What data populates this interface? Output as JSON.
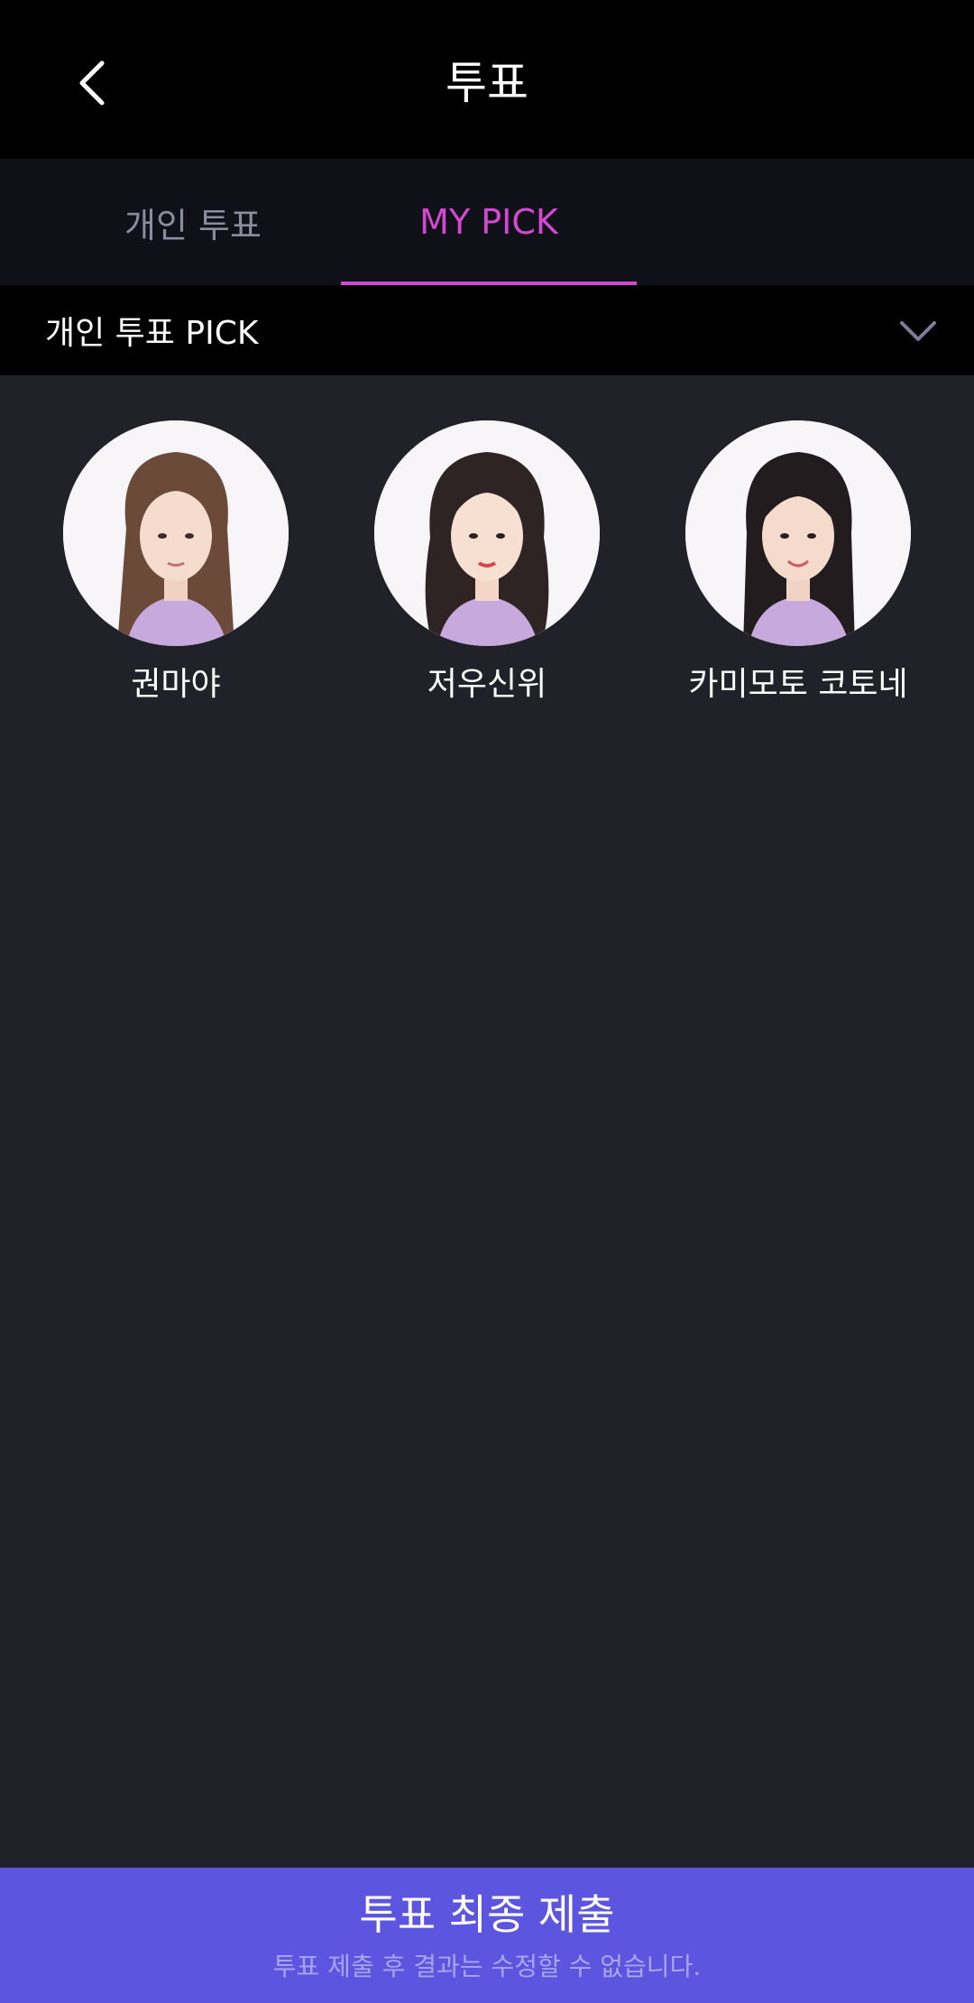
{
  "header": {
    "title": "투표",
    "back_icon": "chevron-left-icon"
  },
  "tabs": [
    {
      "label": "개인 투표",
      "active": false
    },
    {
      "label": "MY PICK",
      "active": true
    }
  ],
  "dropdown": {
    "label": "개인 투표 PICK",
    "icon": "chevron-down-icon"
  },
  "picks": [
    {
      "name": "권마야"
    },
    {
      "name": "저우신위"
    },
    {
      "name": "카미모토 코토네"
    }
  ],
  "submit": {
    "title": "투표 최종 제출",
    "note": "투표 제출 후 결과는 수정할 수 없습니다."
  },
  "colors": {
    "accent": "#d049cf",
    "submit_bg": "#5b55e0",
    "content_bg": "#212229",
    "tab_bar_bg": "#101019"
  }
}
